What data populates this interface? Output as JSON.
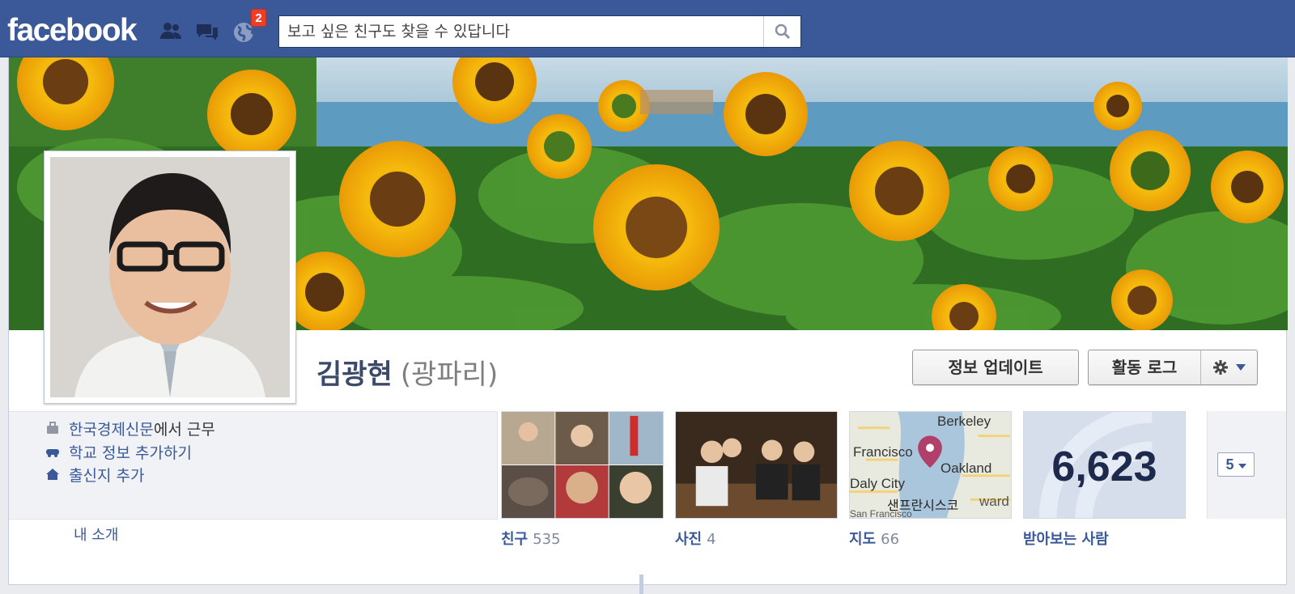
{
  "header": {
    "logo_text": "facebook",
    "notification_count": "2",
    "search_placeholder": "보고 싶은 친구도 찾을 수 있답니다",
    "icons": [
      "friend-requests-icon",
      "messages-icon",
      "notifications-globe-icon",
      "search-icon"
    ],
    "bar_color": "#3b5998"
  },
  "profile": {
    "name": "김광현",
    "alternate_name": "(광파리)",
    "cover_subject": "sunflower field by the sea",
    "picture_subject": "man with glasses in white shirt"
  },
  "actions": {
    "update_info_label": "정보 업데이트",
    "activity_log_label": "활동 로그",
    "settings_icon": "gear-icon"
  },
  "info": {
    "work_org": "한국경제신문",
    "work_suffix": "에서 근무",
    "school": "학교 정보 추가하기",
    "hometown": "출신지 추가",
    "about_link": "내 소개"
  },
  "apps": [
    {
      "label": "친구",
      "count": "535"
    },
    {
      "label": "사진",
      "count": "4"
    },
    {
      "label": "지도",
      "count": "66"
    },
    {
      "label": "받아보는 사람",
      "count": "",
      "big_number": "6,623"
    }
  ],
  "map_labels": [
    "Berkeley",
    "Francisco",
    "Oakland",
    "Daly City",
    "샌프란시스코",
    "ward",
    "San Francisco"
  ],
  "more_apps_count": "5"
}
